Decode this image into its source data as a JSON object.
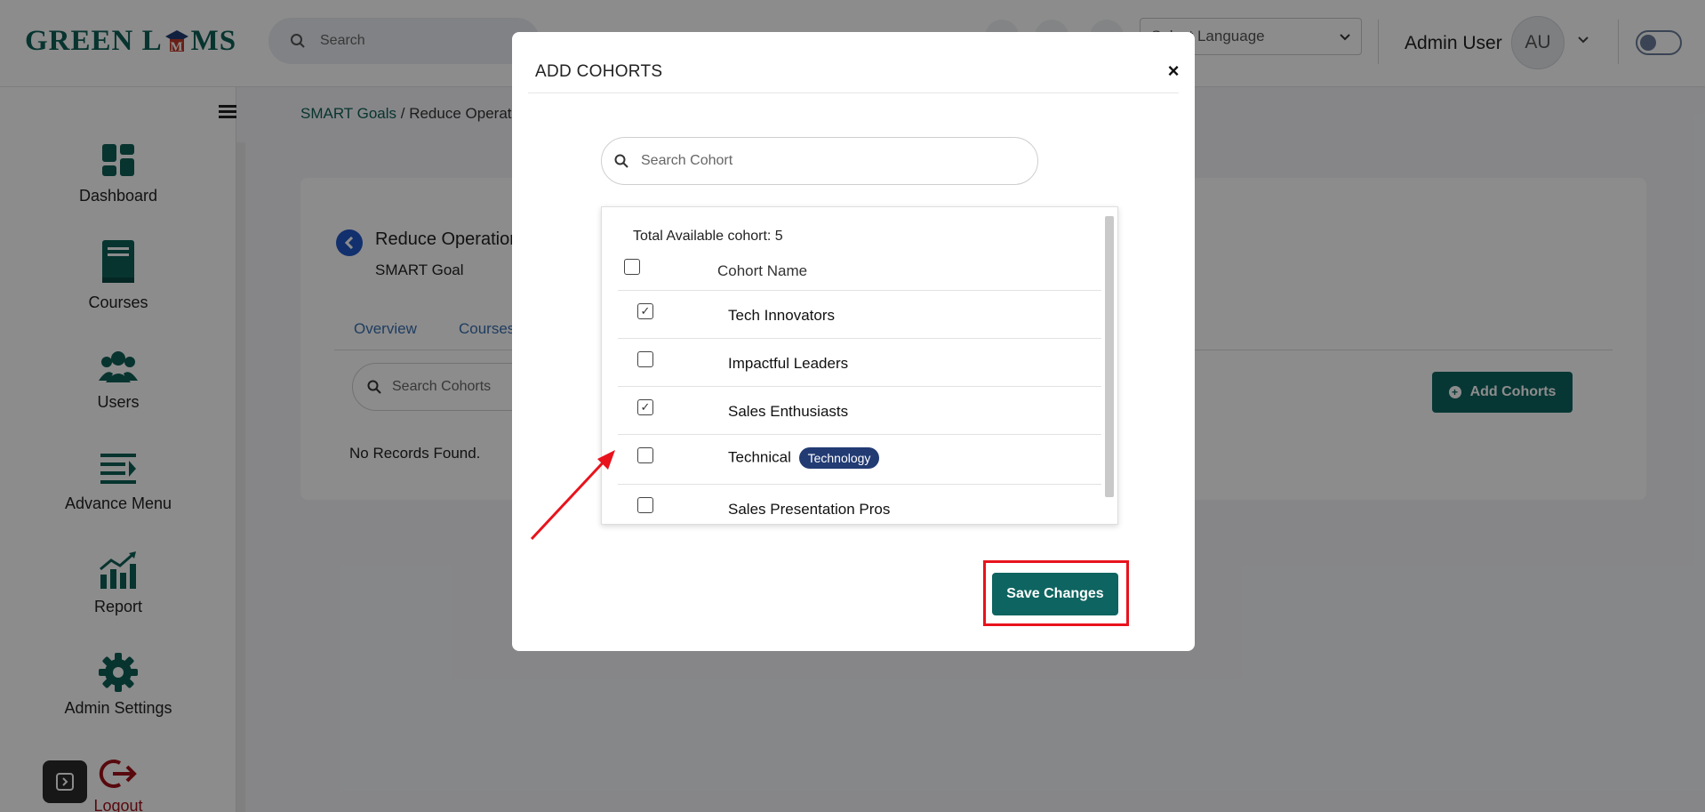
{
  "header": {
    "logo_text_1": "GREEN L",
    "logo_text_2": "MS",
    "logo_mark": "M",
    "search_placeholder": "Search",
    "language_select": "Select Language",
    "admin_name": "Admin User",
    "avatar_initials": "AU"
  },
  "sidebar": {
    "items": [
      {
        "label": "Dashboard",
        "icon": "dashboard-icon"
      },
      {
        "label": "Courses",
        "icon": "book-icon"
      },
      {
        "label": "Users",
        "icon": "users-icon"
      },
      {
        "label": "Advance Menu",
        "icon": "menu-list-icon"
      },
      {
        "label": "Report",
        "icon": "chart-icon"
      },
      {
        "label": "Admin Settings",
        "icon": "gear-icon"
      },
      {
        "label": "Logout",
        "icon": "logout-icon"
      }
    ]
  },
  "main": {
    "breadcrumb_link": "SMART Goals",
    "breadcrumb_separator": " / ",
    "breadcrumb_current": "Reduce Operatio",
    "goal_title": "Reduce Operation",
    "goal_subtitle": "SMART Goal",
    "tabs": [
      "Overview",
      "Courses"
    ],
    "search_cohorts_placeholder": "Search Cohorts",
    "no_records": "No Records Found.",
    "add_cohorts_label": "Add Cohorts"
  },
  "modal": {
    "title": "ADD COHORTS",
    "close_symbol": "×",
    "search_placeholder": "Search Cohort",
    "total_label": "Total Available cohort: 5",
    "column_header": "Cohort Name",
    "rows": [
      {
        "name": "Tech Innovators",
        "checked": true,
        "tag": ""
      },
      {
        "name": "Impactful Leaders",
        "checked": false,
        "tag": ""
      },
      {
        "name": "Sales Enthusiasts",
        "checked": true,
        "tag": ""
      },
      {
        "name": "Technical",
        "checked": false,
        "tag": "Technology"
      },
      {
        "name": "Sales Presentation Pros",
        "checked": false,
        "tag": ""
      }
    ],
    "save_label": "Save Changes"
  },
  "colors": {
    "brand_green": "#0e6460",
    "tag_navy": "#223b73",
    "highlight_red": "#e8131c",
    "back_blue": "#2258c7"
  }
}
